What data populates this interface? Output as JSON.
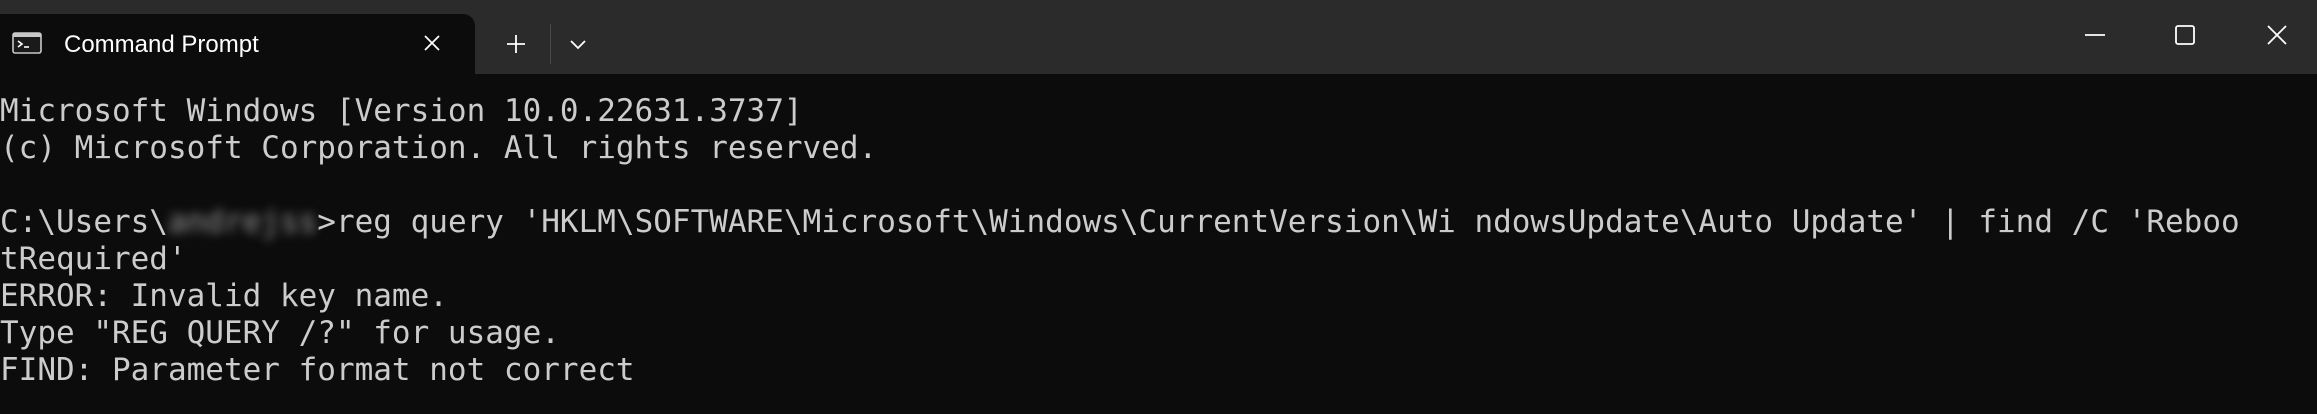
{
  "window": {
    "tab_title": "Command Prompt",
    "icons": {
      "tab": "command-prompt-icon",
      "close_tab": "close-icon",
      "new_tab": "plus-icon",
      "dropdown": "chevron-down-icon",
      "minimize": "minimize-icon",
      "maximize": "maximize-icon",
      "close_window": "close-icon"
    },
    "colors": {
      "titlebar": "#2b2b2b",
      "background": "#0c0c0c",
      "text": "#cccccc"
    }
  },
  "terminal": {
    "line1": "Microsoft Windows [Version 10.0.22631.3737]",
    "line2": "(c) Microsoft Corporation. All rights reserved.",
    "prompt_prefix": "C:\\Users\\",
    "redacted_username": "andrejss",
    "command_line1": ">reg query 'HKLM\\SOFTWARE\\Microsoft\\Windows\\CurrentVersion\\Wi ndowsUpdate\\Auto Update' | find /C 'Reboo",
    "command_line2": "tRequired'",
    "error1": "ERROR: Invalid key name.",
    "error2": "Type \"REG QUERY /?\" for usage.",
    "error3": "FIND: Parameter format not correct"
  }
}
